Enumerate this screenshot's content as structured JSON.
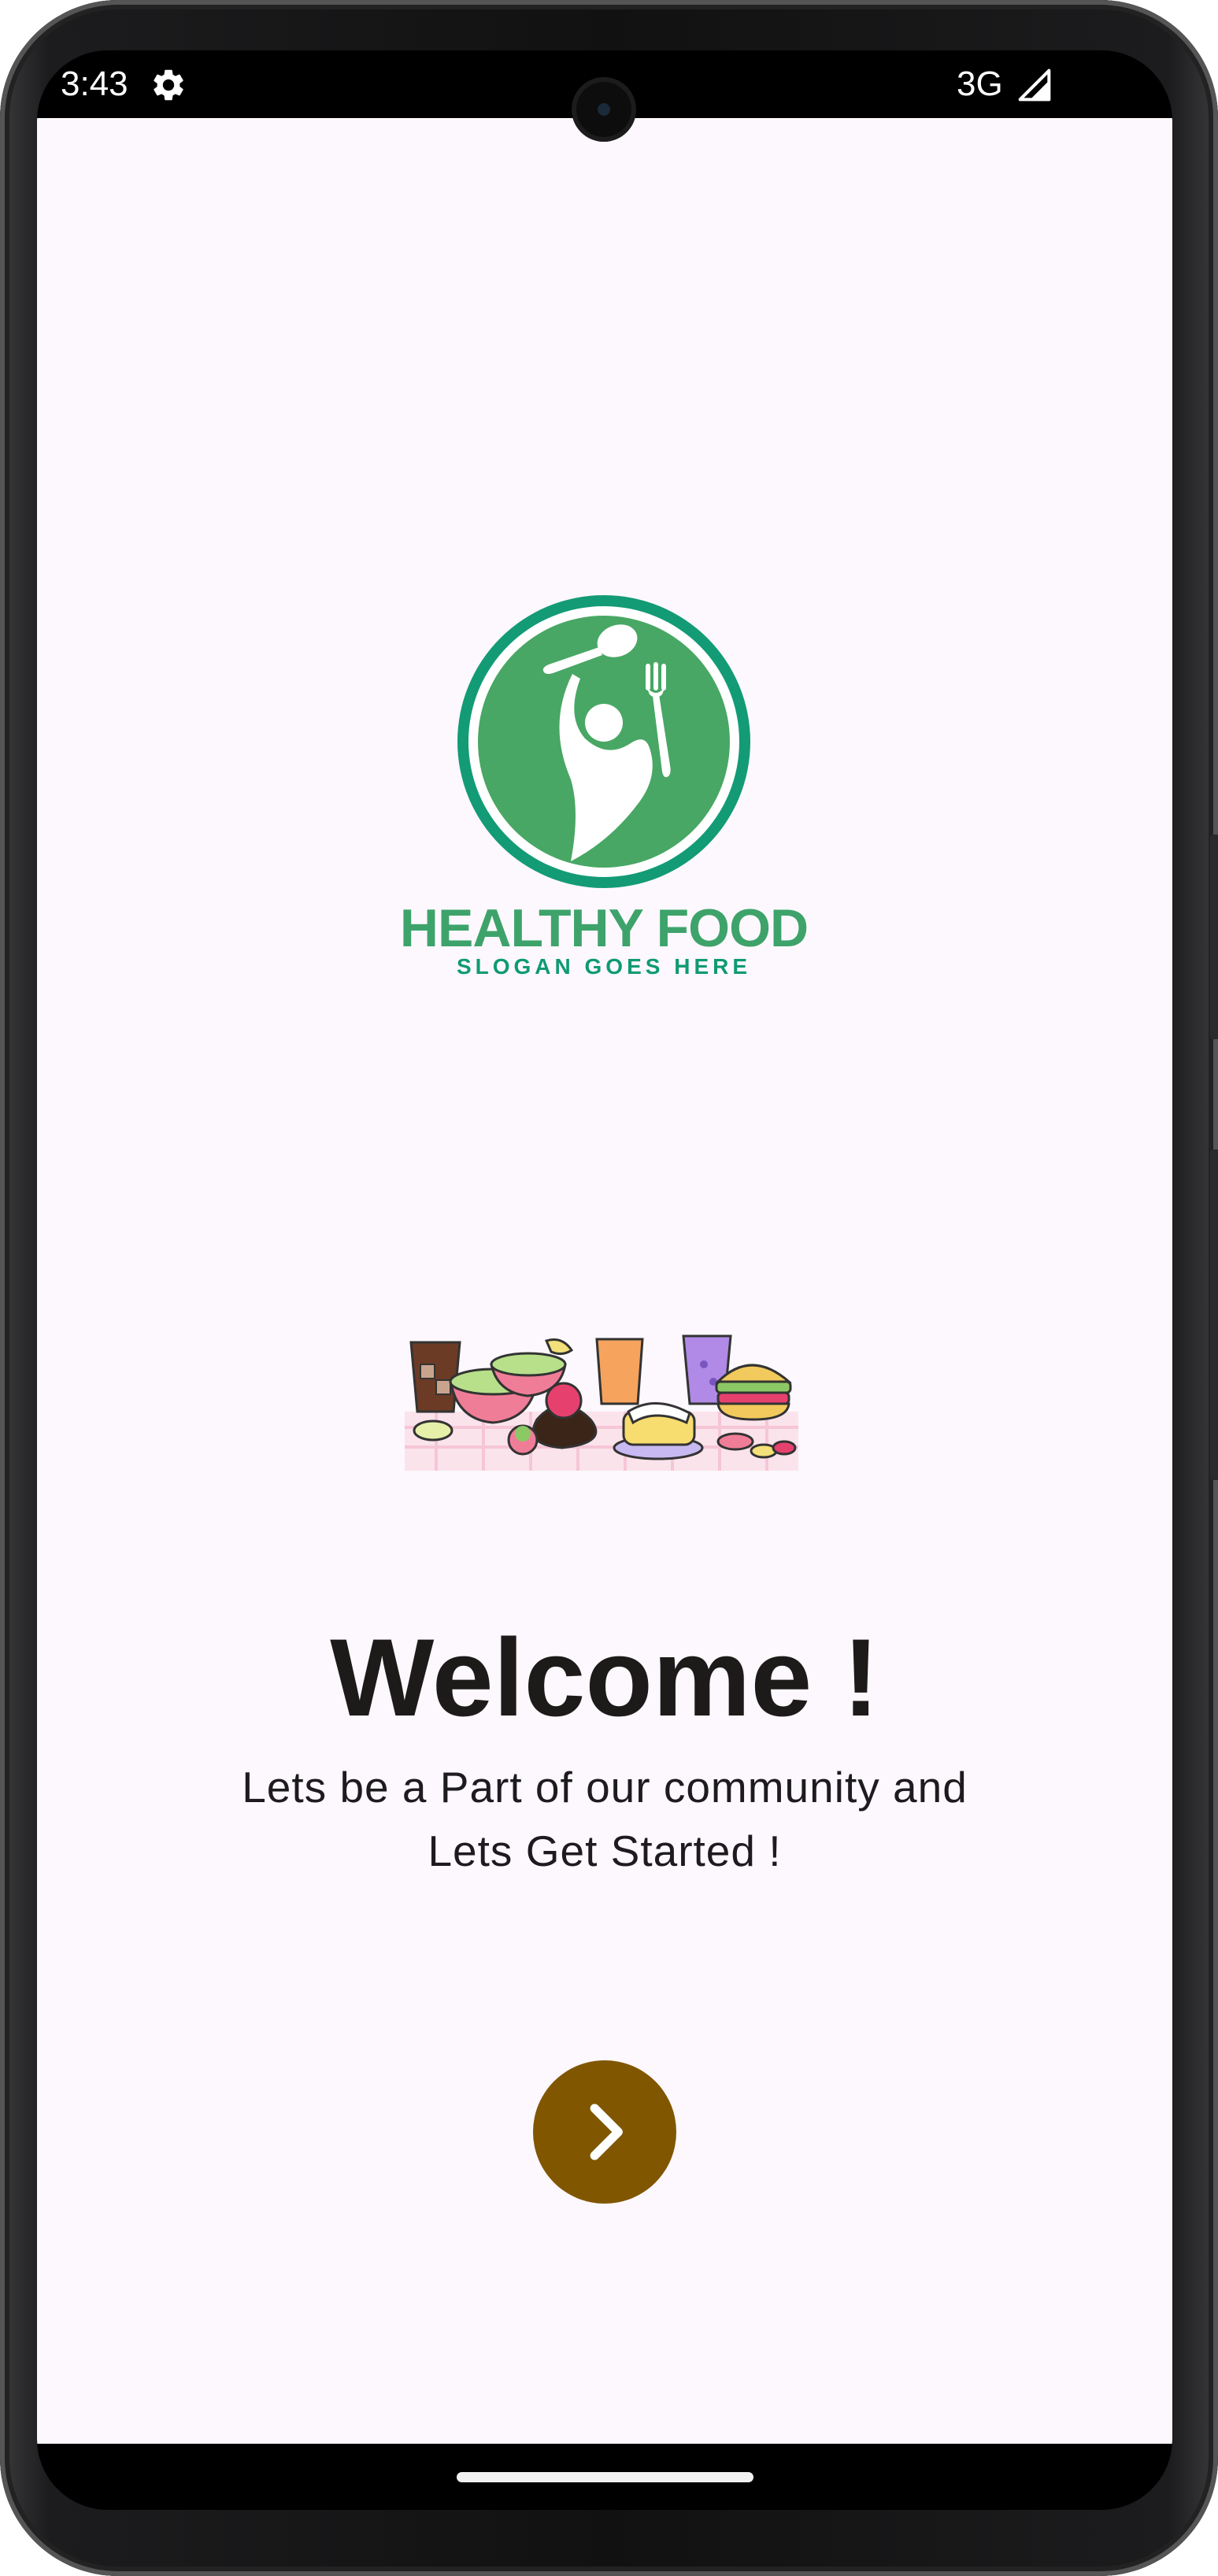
{
  "status_bar": {
    "time": "3:43",
    "settings_icon": "gear-icon",
    "network": "3G",
    "signal_icon": "signal-icon"
  },
  "logo": {
    "title": "HEALTHY FOOD",
    "slogan": "SLOGAN GOES HERE",
    "colors": {
      "ring": "#139b76",
      "fill": "#48a764"
    }
  },
  "illustration": {
    "icon": "food-spread-illustration"
  },
  "welcome": {
    "title": "Welcome !",
    "subtitle_line1": "Lets be a Part of our community and",
    "subtitle_line2": "Lets Get Started !"
  },
  "next_button": {
    "icon": "chevron-right-icon",
    "color": "#805600"
  },
  "colors": {
    "background": "#fcf8fd",
    "text": "#1c1b1a"
  }
}
